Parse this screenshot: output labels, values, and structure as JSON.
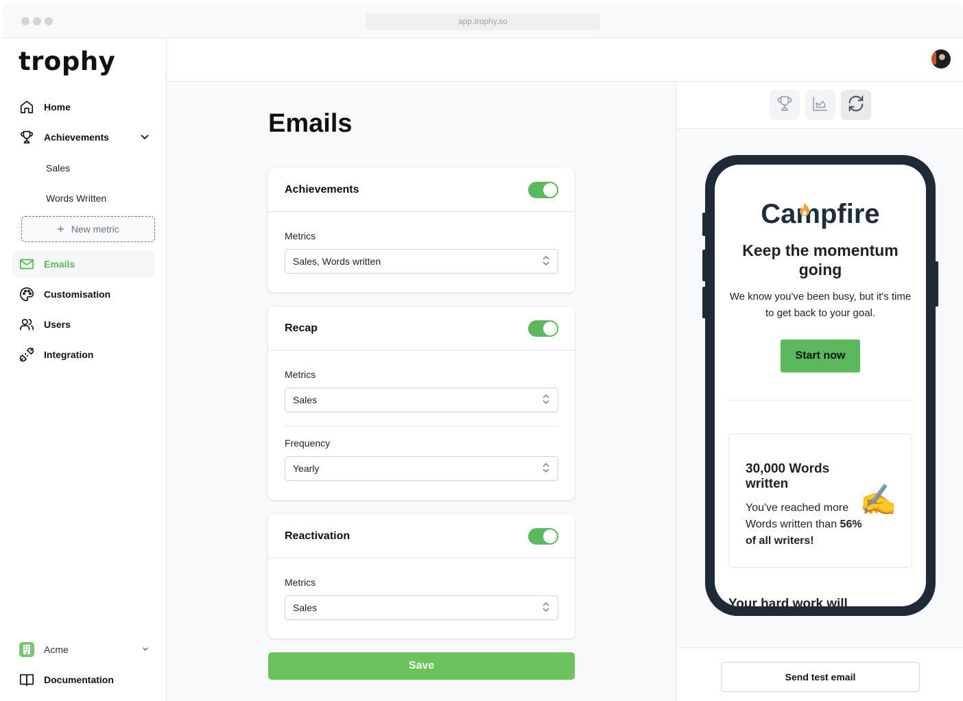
{
  "browser": {
    "url": "app.trophy.so"
  },
  "sidebar": {
    "logo": "trophy",
    "items": [
      {
        "label": "Home",
        "icon": "home-icon"
      },
      {
        "label": "Achievements",
        "icon": "trophy-icon",
        "expanded": true
      },
      {
        "label": "Emails",
        "icon": "mail-icon",
        "active": true
      },
      {
        "label": "Customisation",
        "icon": "palette-icon"
      },
      {
        "label": "Users",
        "icon": "users-icon"
      },
      {
        "label": "Integration",
        "icon": "plug-icon"
      }
    ],
    "achievement_subitems": [
      "Sales",
      "Words Written"
    ],
    "new_metric_label": "New metric",
    "org": {
      "name": "Acme",
      "icon": "building-icon"
    },
    "documentation_label": "Documentation"
  },
  "main": {
    "title": "Emails",
    "cards": [
      {
        "title": "Achievements",
        "enabled": true,
        "fields": [
          {
            "label": "Metrics",
            "value": "Sales, Words written"
          }
        ]
      },
      {
        "title": "Recap",
        "enabled": true,
        "fields": [
          {
            "label": "Metrics",
            "value": "Sales"
          },
          {
            "label": "Frequency",
            "value": "Yearly"
          }
        ]
      },
      {
        "title": "Reactivation",
        "enabled": true,
        "fields": [
          {
            "label": "Metrics",
            "value": "Sales"
          }
        ]
      }
    ],
    "save_label": "Save"
  },
  "preview": {
    "tabs": [
      {
        "icon": "trophy-icon",
        "active": false
      },
      {
        "icon": "chart-icon",
        "active": false
      },
      {
        "icon": "refresh-icon",
        "active": true
      }
    ],
    "email": {
      "brand": "Campfire",
      "title": "Keep the momentum going",
      "body": "We know you've been busy, but it's time to get back to your goal.",
      "cta": "Start now",
      "achievement": {
        "title": "30,000 Words written",
        "text": "You've reached more Words written than",
        "highlight": "56% of all writers!",
        "emoji": "✍️"
      },
      "cutoff_text": "Your hard work will"
    },
    "send_test_label": "Send test email"
  },
  "colors": {
    "accent": "#5cb85c",
    "save_button": "#6cc25c",
    "phone_frame": "#1f2937",
    "brand_text": "#1f2d3d",
    "flame": "#f0a030"
  }
}
